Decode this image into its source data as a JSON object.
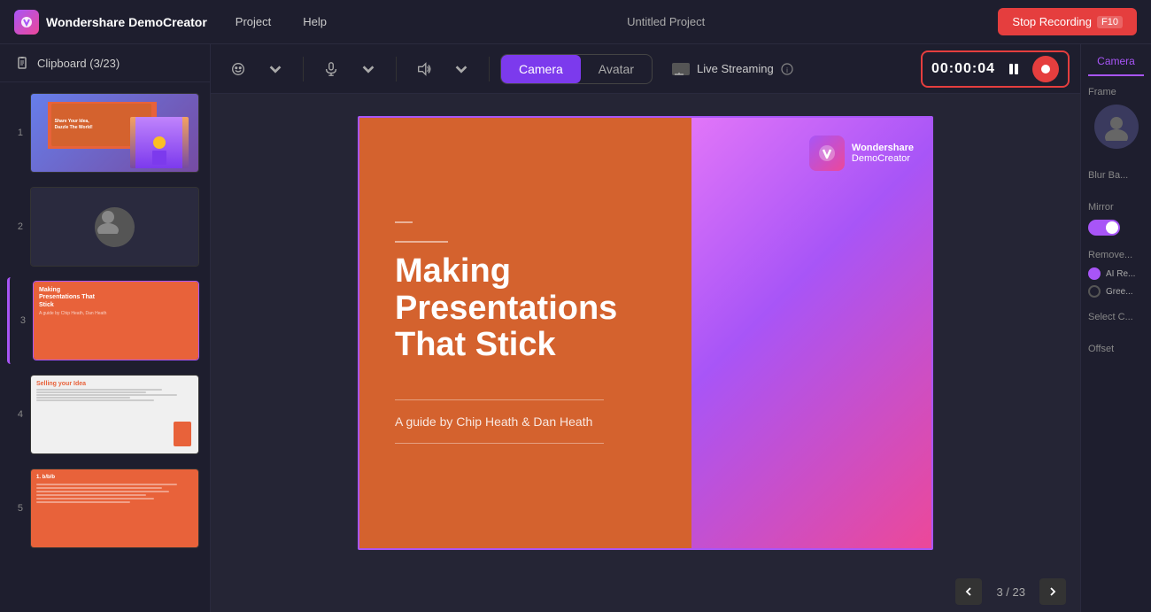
{
  "app": {
    "name": "Wondershare DemoCreator",
    "logo_char": "W"
  },
  "topbar": {
    "project_name": "Untitled Project",
    "menu_items": [
      "Project",
      "Help"
    ],
    "stop_recording_label": "Stop Recording",
    "shortcut": "F10"
  },
  "sidebar": {
    "title": "Clipboard (3/23)",
    "slides": [
      {
        "number": "1",
        "type": "intro"
      },
      {
        "number": "2",
        "type": "person"
      },
      {
        "number": "3",
        "type": "title-slide",
        "active": true
      },
      {
        "number": "4",
        "type": "selling"
      },
      {
        "number": "5",
        "type": "list"
      }
    ]
  },
  "toolbar": {
    "camera_label": "Camera",
    "avatar_label": "Avatar",
    "streaming_label": "Live Streaming",
    "timer": "00:00:04",
    "tools": [
      "microphone",
      "volume",
      "face"
    ]
  },
  "right_panel": {
    "tab_label": "Camera",
    "frame_label": "Frame",
    "blur_bg_label": "Blur Ba...",
    "mirror_label": "Mirror",
    "remove_label": "Remove...",
    "ai_re_label": "AI Re...",
    "green_label": "Gree...",
    "select_label": "Select C...",
    "offset_label": "Offset"
  },
  "slide": {
    "dash": "—",
    "main_title": "Making Presentations That Stick",
    "subtitle": "A guide by Chip Heath & Dan Heath",
    "watermark_line1": "Wondershare",
    "watermark_line2": "DemoCreator"
  },
  "canvas": {
    "slide_counter": "3 / 23"
  }
}
